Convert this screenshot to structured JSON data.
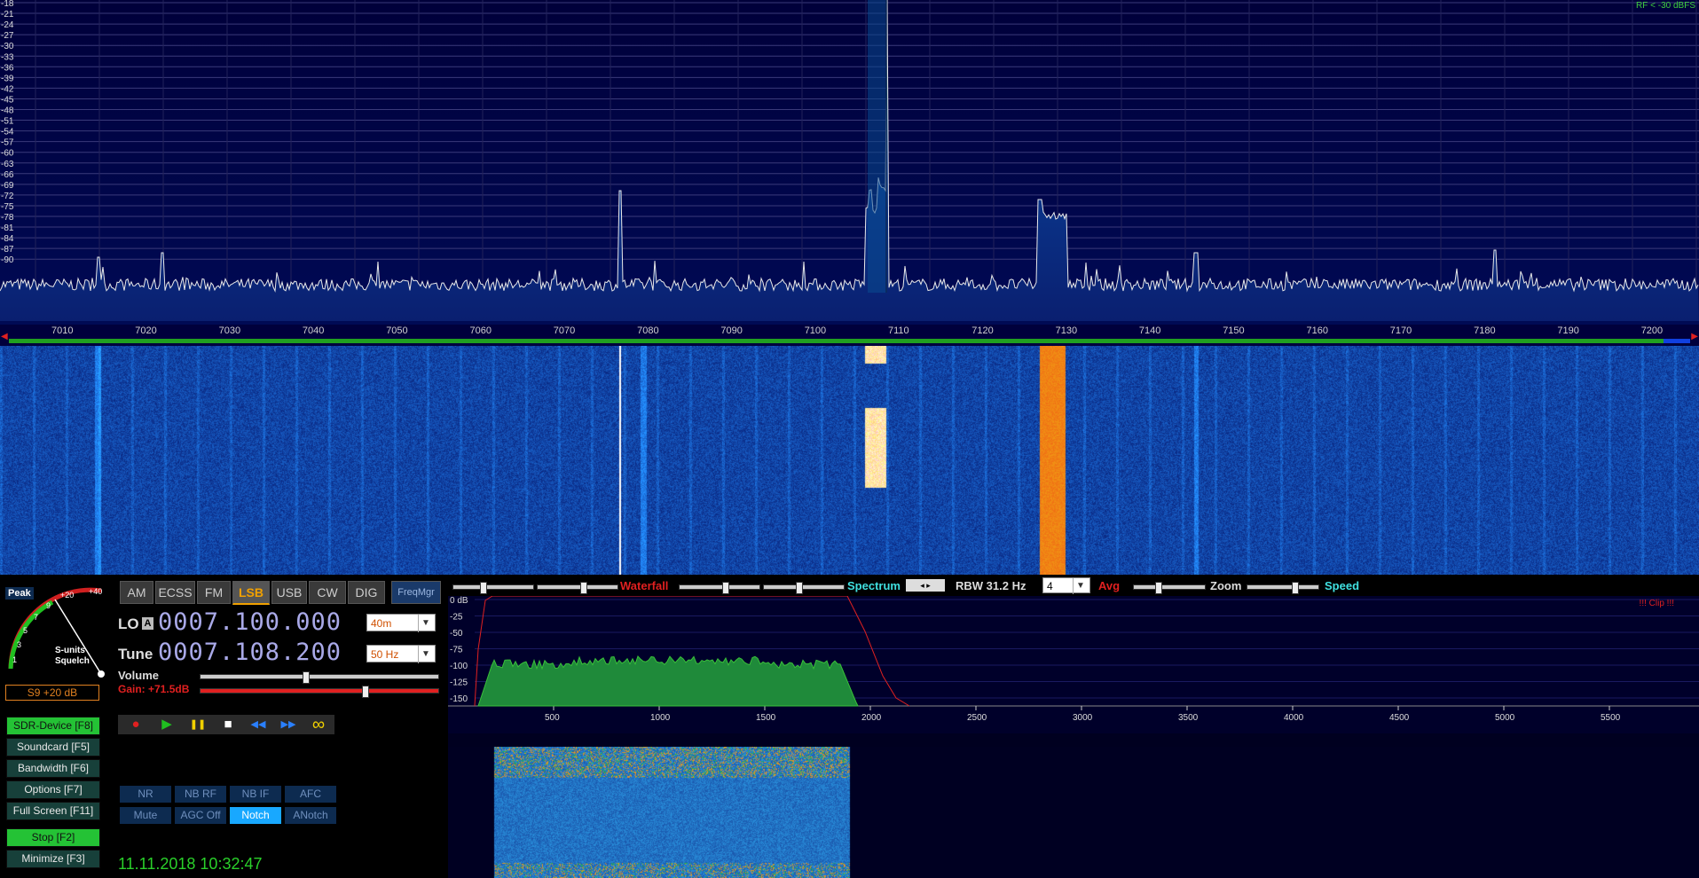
{
  "spectrum": {
    "rf_label": "RF < -30 dBFS",
    "db_labels": [
      "-18",
      "-21",
      "-24",
      "-27",
      "-30",
      "-33",
      "-36",
      "-39",
      "-42",
      "-45",
      "-48",
      "-51",
      "-54",
      "-57",
      "-60",
      "-63",
      "-66",
      "-69",
      "-72",
      "-75",
      "-78",
      "-81",
      "-84",
      "-87",
      "-90"
    ],
    "freq_labels": [
      "7010",
      "7020",
      "7030",
      "7040",
      "7050",
      "7060",
      "7070",
      "7080",
      "7090",
      "7100",
      "7110",
      "7120",
      "7130",
      "7140",
      "7150",
      "7160",
      "7170",
      "7180",
      "7190",
      "7200"
    ]
  },
  "meter": {
    "peak_label": "Peak",
    "scale_labels": [
      "1",
      "3",
      "5",
      "7",
      "9",
      "+20",
      "+40"
    ],
    "s_units_label": "S-units",
    "squelch_label": "Squelch",
    "reading": "S9 +20 dB"
  },
  "modes": {
    "items": [
      "AM",
      "ECSS",
      "FM",
      "LSB",
      "USB",
      "CW",
      "DIG"
    ],
    "active": "LSB",
    "freqmgr": "FreqMgr"
  },
  "lo": {
    "label": "LO",
    "badge": "A",
    "value": "0007.100.000",
    "band": "40m"
  },
  "tune": {
    "label": "Tune",
    "value": "0007.108.200",
    "step": "50 Hz"
  },
  "volume": {
    "label": "Volume",
    "gain": "Gain: +71.5dB",
    "volume_level": 0.44,
    "gain_level": 0.69
  },
  "playback": {
    "record": "●",
    "play": "▶",
    "pause": "❚❚",
    "stop": "■",
    "rewind": "◀◀",
    "forward": "▶▶",
    "loop": "∞"
  },
  "function_keys": [
    {
      "label": "SDR-Device [F8]",
      "green": true
    },
    {
      "label": "Soundcard [F5]",
      "green": false
    },
    {
      "label": "Bandwidth [F6]",
      "green": false
    },
    {
      "label": "Options [F7]",
      "green": false
    },
    {
      "label": "Full Screen [F11]",
      "green": false
    },
    {
      "label": "Stop [F2]",
      "green": true
    },
    {
      "label": "Minimize [F3]",
      "green": false
    }
  ],
  "dsp": {
    "nr": "NR",
    "nb_rf": "NB RF",
    "nb_if": "NB IF",
    "afc": "AFC",
    "mute": "Mute",
    "agc": "AGC Off",
    "notch": "Notch",
    "anotch": "ANotch"
  },
  "datetime": "11.11.2018 10:32:47",
  "toolbar": {
    "waterfall": "Waterfall",
    "spectrum": "Spectrum",
    "rbw": "RBW 31.2 Hz",
    "avg_value": "4",
    "avg": "Avg",
    "zoom": "Zoom",
    "speed": "Speed"
  },
  "audio": {
    "clip": "!!! Clip !!!",
    "db_labels": [
      "0 dB",
      "-25",
      "-50",
      "-75",
      "-100",
      "-125",
      "-150"
    ],
    "hz_labels": [
      "500",
      "1000",
      "1500",
      "2000",
      "2500",
      "3000",
      "3500",
      "4000",
      "4500",
      "5000",
      "5500"
    ]
  },
  "colors": {
    "accent_green": "#24c235",
    "accent_red": "#e02020",
    "accent_cyan": "#40e0e0",
    "notch_blue": "#18a8ff"
  }
}
